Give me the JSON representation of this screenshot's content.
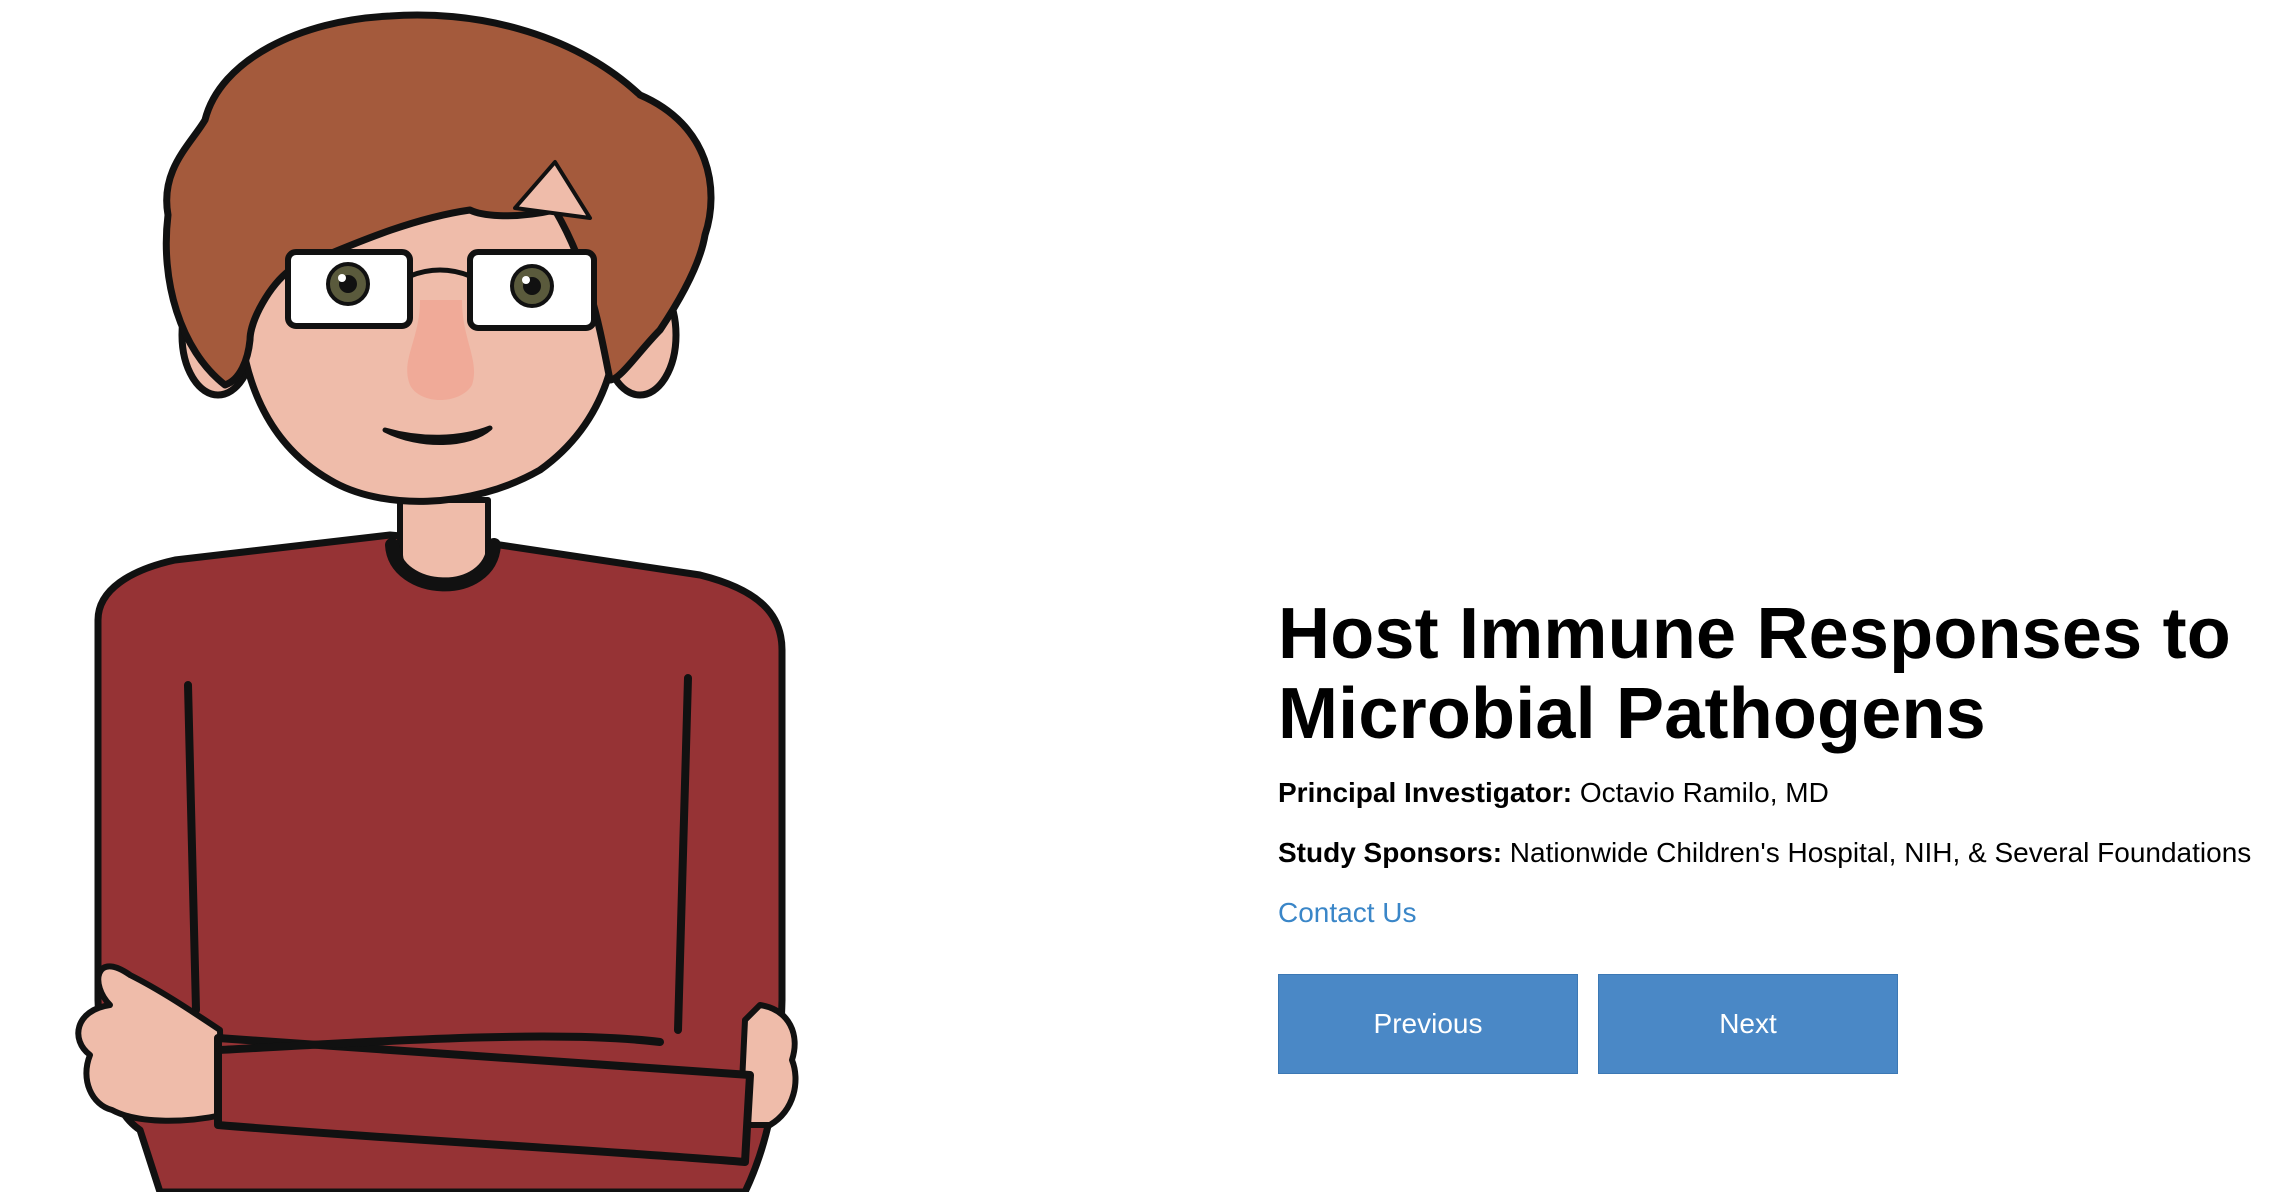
{
  "illustration": {
    "icon": "person-arms-crossed-illustration",
    "colors": {
      "hair": "#a45a3c",
      "skin": "#efbcaa",
      "shirt": "#963335",
      "outline": "#111111"
    }
  },
  "study": {
    "title": "Host Immune Responses to Microbial Pathogens",
    "principal_investigator_label": "Principal Investigator:",
    "principal_investigator": "Octavio Ramilo, MD",
    "sponsors_label": "Study Sponsors:",
    "sponsors": "Nationwide Children's Hospital, NIH, & Several Foundations",
    "contact_label": "Contact Us"
  },
  "navigation": {
    "previous_label": "Previous",
    "next_label": "Next",
    "button_color": "#4a88c6",
    "link_color": "#3a86c8"
  }
}
